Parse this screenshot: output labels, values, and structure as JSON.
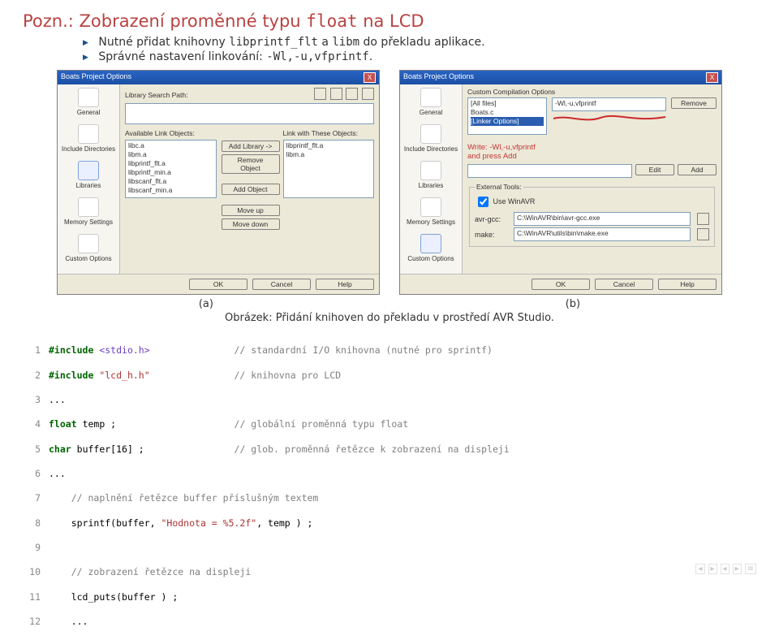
{
  "title_prefix": "Pozn.:",
  "title_rest_1": "Zobrazení proměnné typu ",
  "title_code": "float",
  "title_rest_2": " na LCD",
  "bullet1_pre": "Nutné přidat knihovny ",
  "bullet1_c1": "libprintf_flt",
  "bullet1_mid": " a ",
  "bullet1_c2": "libm",
  "bullet1_post": " do překladu aplikace.",
  "bullet2_pre": "Správné nastavení linkování: ",
  "bullet2_code": "-Wl,-u,vfprintf",
  "bullet2_post": ".",
  "dialogA": {
    "title": "Boats Project Options",
    "close": "X",
    "sidebar": [
      "General",
      "Include Directories",
      "Libraries",
      "Memory Settings",
      "Custom Options"
    ],
    "libSearchPath": "Library Search Path:",
    "availableLabel": "Available Link Objects:",
    "withLabel": "Link with These Objects:",
    "available": [
      "libc.a",
      "libm.a",
      "libprintf_flt.a",
      "libprintf_min.a",
      "libscanf_flt.a",
      "libscanf_min.a"
    ],
    "with": [
      "libprintf_flt.a",
      "libm.a"
    ],
    "btnAddLib": "Add Library ->",
    "btnRemoveObj": "Remove Object",
    "btnAddObj": "Add Object",
    "btnMoveUp": "Move up",
    "btnMoveDown": "Move down",
    "btns": [
      "OK",
      "Cancel",
      "Help"
    ]
  },
  "dialogB": {
    "title": "Boats Project Options",
    "close": "X",
    "sidebar": [
      "General",
      "Include Directories",
      "Libraries",
      "Memory Settings",
      "Custom Options"
    ],
    "customLabel": "Custom Compilation Options",
    "listItems": [
      "[All files]",
      "Boats.c",
      "[Linker Options]"
    ],
    "optValue": "-Wl,-u,vfprintf",
    "btnRemove": "Remove",
    "hint1": "Write: -Wl,-u,vfprintf",
    "hint2": "and press Add",
    "btnEdit": "Edit",
    "btnAdd": "Add",
    "externalTools": "External Tools:",
    "useWinAVR": "Use WinAVR",
    "gccLabel": "avr-gcc:",
    "gccPath": "C:\\WinAVR\\bin\\avr-gcc.exe",
    "makeLabel": "make:",
    "makePath": "C:\\WinAVR\\utils\\bin\\make.exe",
    "btns": [
      "OK",
      "Cancel",
      "Help"
    ]
  },
  "capA": "(a)",
  "capB": "(b)",
  "figcap_pre": "Obrázek:",
  "figcap_rest": " Přidání knihoven do překladu v prostředí AVR Studio.",
  "code": {
    "l1": {
      "n": "1",
      "kw1": "#include",
      "hdr": "<stdio.h>",
      "cm": "// standardní I/O knihovna (nutné pro sprintf)"
    },
    "l2": {
      "n": "2",
      "kw1": "#include",
      "hdr": "\"lcd_h.h\"",
      "cm": "// knihovna pro LCD"
    },
    "l3": {
      "n": "3",
      "txt": "..."
    },
    "l4": {
      "n": "4",
      "ty": "float",
      "id": "temp ;",
      "cm": "// globální proměnná typu float"
    },
    "l5": {
      "n": "5",
      "ty": "char",
      "id": "buffer[16] ;",
      "cm": "// glob. proměnná řetězce k zobrazení na displeji"
    },
    "l6": {
      "n": "6",
      "txt": "..."
    },
    "l7": {
      "n": "7",
      "cm": "// naplnění řetězce buffer příslušným textem"
    },
    "l8": {
      "n": "8",
      "fn": "sprintf(",
      "args_a": "buffer, ",
      "str": "\"Hodnota = %5.2f\"",
      "args_b": ", temp ) ;"
    },
    "l9": {
      "n": "9"
    },
    "l10": {
      "n": "10",
      "cm": "// zobrazení řetězce na displeji"
    },
    "l11": {
      "n": "11",
      "fn": "lcd_puts(",
      "args": "buffer ) ;"
    },
    "l12": {
      "n": "12",
      "txt": "..."
    }
  },
  "nav": {
    "a": "◂",
    "b": "▸",
    "c": "◂",
    "d": "▸",
    "e": "≡"
  }
}
